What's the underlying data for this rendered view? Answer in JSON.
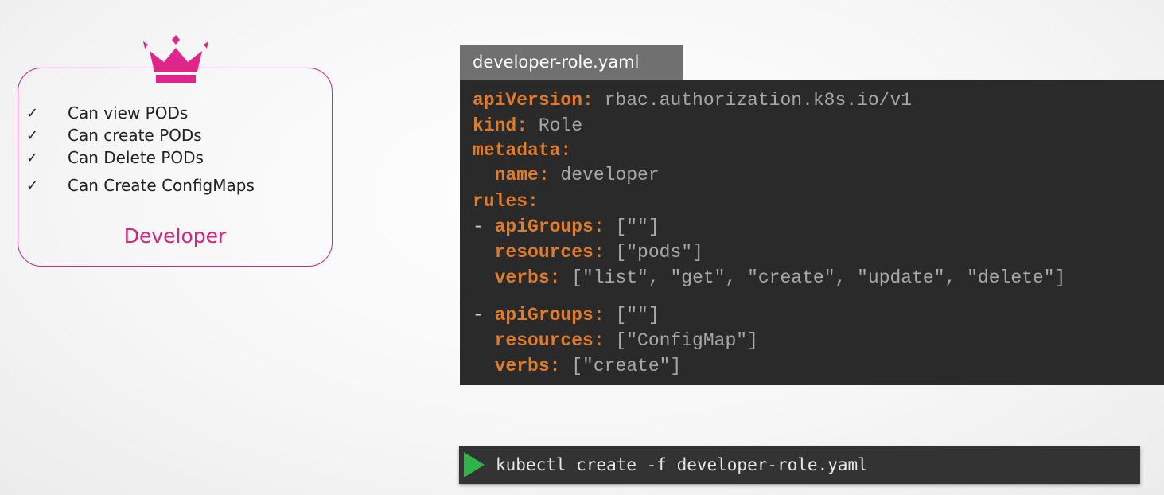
{
  "developer": {
    "icon": "crown-icon",
    "permissions": [
      "Can view PODs",
      "Can create PODs",
      "Can Delete PODs",
      "Can Create ConfigMaps"
    ],
    "check_mark": "✓",
    "role_label": "Developer",
    "accent_color": "#d6247f"
  },
  "file": {
    "name": "developer-role.yaml",
    "lines": [
      {
        "key": "apiVersion:",
        "value": " rbac.authorization.k8s.io/v1"
      },
      {
        "key": "kind:",
        "value": " Role"
      },
      {
        "key": "metadata:",
        "value": ""
      },
      {
        "prefix": "  ",
        "key": "name:",
        "value": " developer"
      },
      {
        "key": "rules:",
        "value": ""
      },
      {
        "prefix": "- ",
        "key": "apiGroups:",
        "value": " [\"\"]"
      },
      {
        "prefix": "  ",
        "key": "resources:",
        "value": " [\"pods\"]"
      },
      {
        "prefix": "  ",
        "key": "verbs:",
        "value": " [\"list\", \"get\", \"create\", \"update\", \"delete\"]"
      },
      {
        "prefix": "- ",
        "key": "apiGroups:",
        "value": " [\"\"]"
      },
      {
        "prefix": "  ",
        "key": "resources:",
        "value": " [\"ConfigMap\"]"
      },
      {
        "prefix": "  ",
        "key": "verbs:",
        "value": " [\"create\"]"
      }
    ],
    "key_color": "#e07b2a"
  },
  "terminal": {
    "icon": "play-icon",
    "command": "kubectl create -f developer-role.yaml",
    "icon_color": "#2fb34a"
  }
}
